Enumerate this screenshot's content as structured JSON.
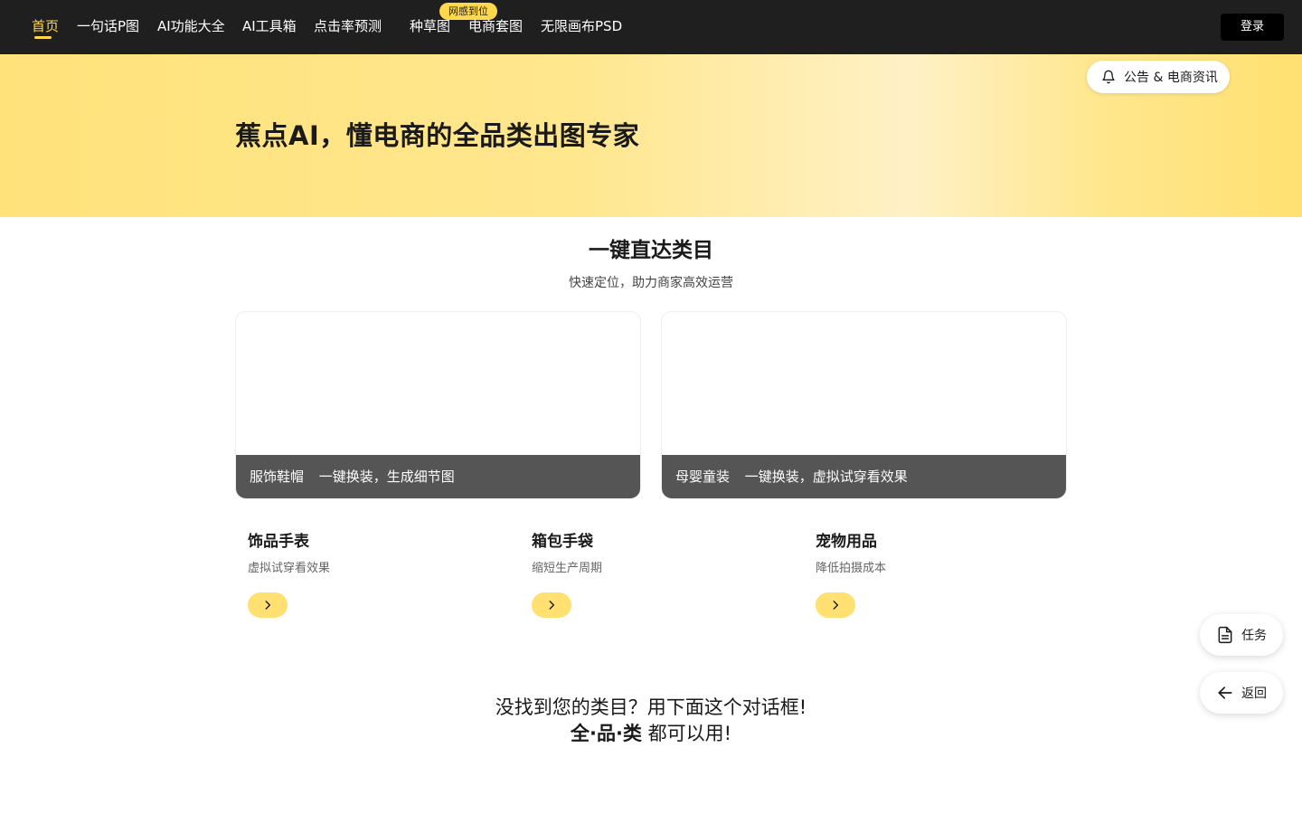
{
  "nav": {
    "items": [
      {
        "label": "首页",
        "active": true
      },
      {
        "label": "一句话P图"
      },
      {
        "label": "AI功能大全"
      },
      {
        "label": "AI工具箱"
      },
      {
        "label": "点击率预测"
      },
      {
        "label": "种草图"
      },
      {
        "label": "电商套图"
      },
      {
        "label": "无限画布PSD"
      }
    ],
    "badge": "网感到位",
    "login_label": "登录"
  },
  "hero": {
    "title": "蕉点AI，懂电商的全品类出图专家",
    "notice_label": "公告 & 电商资讯",
    "notice_icon": "bell-icon"
  },
  "section": {
    "title": "一键直达类目",
    "subtitle": "快速定位，助力商家高效运营"
  },
  "big_cards": [
    {
      "name": "服饰鞋帽",
      "desc": "一键换装，生成细节图"
    },
    {
      "name": "母婴童装",
      "desc": "一键换装，虚拟试穿看效果"
    }
  ],
  "mini_cards": [
    {
      "title": "饰品手表",
      "desc": "虚拟试穿看效果"
    },
    {
      "title": "箱包手袋",
      "desc": "缩短生产周期"
    },
    {
      "title": "宠物用品",
      "desc": "降低拍摄成本"
    }
  ],
  "bottom": {
    "line1": "没找到您的类目？用下面这个对话框!",
    "line2_bold": "全·品·类",
    "line2_rest": " 都可以用!"
  },
  "floating": {
    "task_label": "任务",
    "back_label": "返回"
  },
  "colors": {
    "accent": "#ffd84d",
    "nav_bg": "#1f1f1f",
    "caption_bg": "#555555"
  }
}
